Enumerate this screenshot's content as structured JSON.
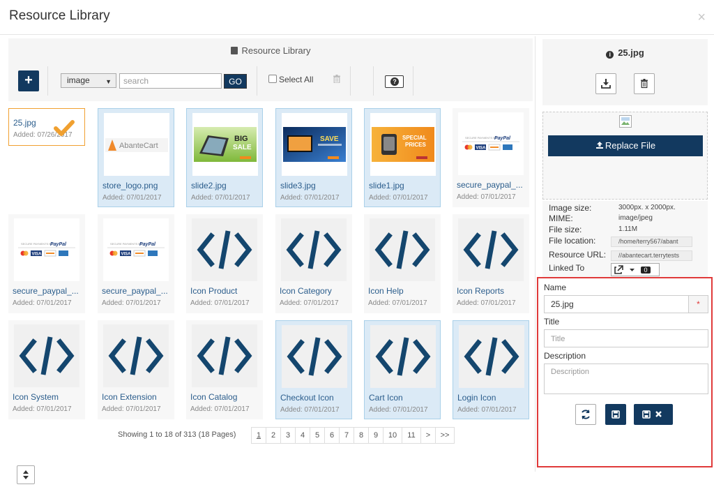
{
  "modal": {
    "title": "Resource Library",
    "close_glyph": "×"
  },
  "library": {
    "heading": "Resource Library",
    "type_select": {
      "value": "image"
    },
    "search": {
      "placeholder": "search"
    },
    "go_label": "GO",
    "select_all_label": "Select All"
  },
  "tiles": [
    {
      "name": "25.jpg",
      "date": "Added: 07/26/2017",
      "state": "selected",
      "thumb": "none"
    },
    {
      "name": "store_logo.png",
      "date": "Added: 07/01/2017",
      "state": "linked",
      "thumb": "logo"
    },
    {
      "name": "slide2.jpg",
      "date": "Added: 07/01/2017",
      "state": "linked",
      "thumb": "slide-big-sale"
    },
    {
      "name": "slide3.jpg",
      "date": "Added: 07/01/2017",
      "state": "linked",
      "thumb": "slide-save"
    },
    {
      "name": "slide1.jpg",
      "date": "Added: 07/01/2017",
      "state": "linked",
      "thumb": "slide-special"
    },
    {
      "name": "secure_paypal_...",
      "date": "Added: 07/01/2017",
      "state": "normal",
      "thumb": "paypal"
    },
    {
      "name": "secure_paypal_...",
      "date": "Added: 07/01/2017",
      "state": "normal",
      "thumb": "paypal"
    },
    {
      "name": "secure_paypal_...",
      "date": "Added: 07/01/2017",
      "state": "normal",
      "thumb": "paypal"
    },
    {
      "name": "Icon Product",
      "date": "Added: 07/01/2017",
      "state": "normal",
      "thumb": "code"
    },
    {
      "name": "Icon Category",
      "date": "Added: 07/01/2017",
      "state": "normal",
      "thumb": "code"
    },
    {
      "name": "Icon Help",
      "date": "Added: 07/01/2017",
      "state": "normal",
      "thumb": "code"
    },
    {
      "name": "Icon Reports",
      "date": "Added: 07/01/2017",
      "state": "normal",
      "thumb": "code"
    },
    {
      "name": "Icon System",
      "date": "Added: 07/01/2017",
      "state": "normal",
      "thumb": "code"
    },
    {
      "name": "Icon Extension",
      "date": "Added: 07/01/2017",
      "state": "normal",
      "thumb": "code"
    },
    {
      "name": "Icon Catalog",
      "date": "Added: 07/01/2017",
      "state": "normal",
      "thumb": "code"
    },
    {
      "name": "Checkout Icon",
      "date": "Added: 07/01/2017",
      "state": "linked",
      "thumb": "code"
    },
    {
      "name": "Cart Icon",
      "date": "Added: 07/01/2017",
      "state": "linked",
      "thumb": "code"
    },
    {
      "name": "Login Icon",
      "date": "Added: 07/01/2017",
      "state": "linked",
      "thumb": "code"
    }
  ],
  "thumb_text": {
    "logo_brand": "AbanteCart",
    "big": "BIG",
    "sale": "SALE",
    "save": "SAVE",
    "special": "SPECIAL",
    "prices": "PRICES",
    "paypal_caption": "SECURE PAYMENTS BY",
    "paypal": "PayPal",
    "visa": "VISA"
  },
  "pagination": {
    "showing": "Showing 1 to 18 of 313 (18 Pages)",
    "pages": [
      "1",
      "2",
      "3",
      "4",
      "5",
      "6",
      "7",
      "8",
      "9",
      "10",
      "11",
      ">",
      ">>"
    ],
    "current": "1"
  },
  "details": {
    "file_title": "25.jpg",
    "replace_label": "Replace File",
    "image_size_label": "Image size:",
    "image_size_value": "3000px. x 2000px.",
    "mime_label": "MIME:",
    "mime_value": "image/jpeg",
    "file_size_label": "File size:",
    "file_size_value": "1.11M",
    "file_location_label": "File location:",
    "file_location_value": "/home/terry567/abant",
    "resource_url_label": "Resource URL:",
    "resource_url_value": "//abantecart.terrytests",
    "linked_to_label": "Linked To",
    "linked_count": "0"
  },
  "form": {
    "name_label": "Name",
    "name_value": "25.jpg",
    "required_mark": "*",
    "title_label": "Title",
    "title_placeholder": "Title",
    "description_label": "Description",
    "description_placeholder": "Description"
  },
  "colors": {
    "primary": "#12395f",
    "link": "#2b5d8c",
    "linked_bg": "#dbeaf6",
    "selected_border": "#f0a030",
    "highlight_red": "#e03a3a"
  }
}
